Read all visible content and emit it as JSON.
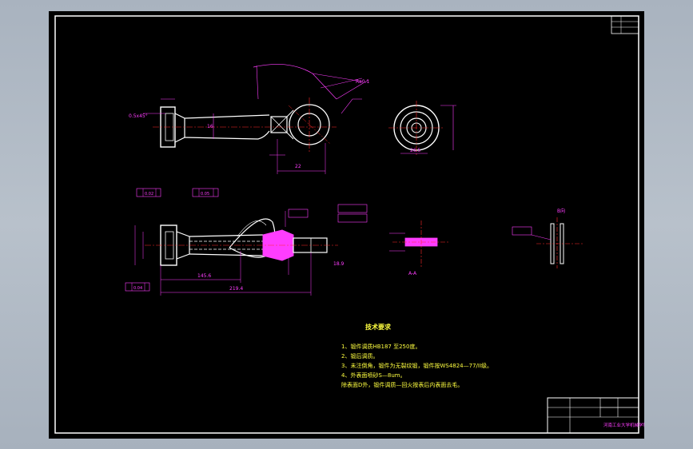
{
  "drawing": {
    "dim_chamfer": "0.5x45°",
    "dim_surface_finish": "Ra0.1",
    "dim_length_total": "219.4",
    "dim_length_shaft": "145.6",
    "dim_a": "22",
    "dim_b": "55",
    "dim_c": "18.9",
    "dim_d": "26.5",
    "dim_e": "16",
    "section_label": "A-A",
    "view_label": "B向",
    "tol_1": "0.02",
    "tol_2": "0.05",
    "tol_3": "0.04"
  },
  "notes": {
    "heading": "技术要求",
    "line1": "1、锻件调质HB187 至250度。",
    "line2": "2、锻后调质。",
    "line3": "3、未注倒角，锻件为无裂纹锻，锻件按WS4824—77/II级。",
    "line4": "4、外表面喷砂S—8um。",
    "line5": "除表面D外，锻件调质—回火按表后内表面去毛。"
  },
  "title_block": {
    "school": "河南工业大学机械学院"
  },
  "colors": {
    "background": "#000000",
    "outline": "#ffffff",
    "dimension": "#ff3dff",
    "notes": "#ffff40",
    "centerline": "#ff2a2a",
    "hatch": "#ff3dff"
  }
}
